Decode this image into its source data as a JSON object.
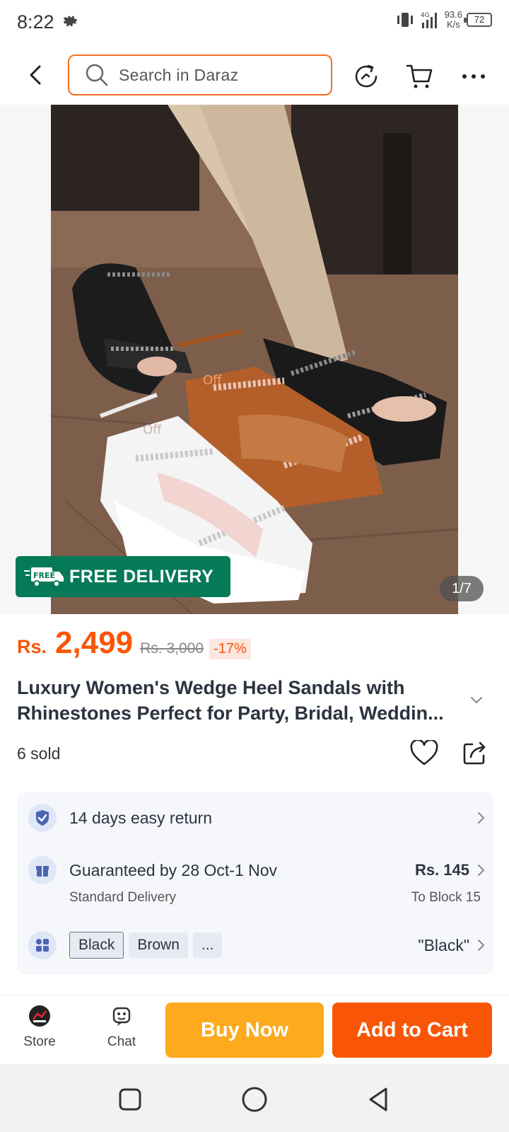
{
  "status_bar": {
    "time": "8:22",
    "net_speed_value": "93.6",
    "net_speed_unit": "K/s",
    "battery": "72"
  },
  "header": {
    "search_placeholder": "Search in Daraz"
  },
  "gallery": {
    "free_delivery_badge": "FREE DELIVERY",
    "free_truck_text": "FREE",
    "image_counter": "1/7",
    "shoe_brand_mark": "Off"
  },
  "product": {
    "currency": "Rs.",
    "price": "2,499",
    "original_price": "Rs. 3,000",
    "discount": "-17%",
    "title_line1": "Luxury Women's Wedge Heel Sandals with",
    "title_line2": "Rhinestones Perfect for Party, Bridal, Weddin...",
    "sold": "6 sold"
  },
  "info": {
    "return_text": "14 days easy return",
    "delivery_text": "Guaranteed by 28 Oct-1 Nov",
    "delivery_type": "Standard Delivery",
    "delivery_fee": "Rs. 145",
    "delivery_location": "To Block 15",
    "variants": [
      "Black",
      "Brown",
      "..."
    ],
    "selected_variant": "\"Black\""
  },
  "actions": {
    "store_label": "Store",
    "chat_label": "Chat",
    "buy_now": "Buy Now",
    "add_to_cart": "Add to Cart"
  },
  "colors": {
    "accent": "#f85606",
    "buy_now": "#fdaa1e",
    "free_delivery_bg": "#047a57"
  }
}
